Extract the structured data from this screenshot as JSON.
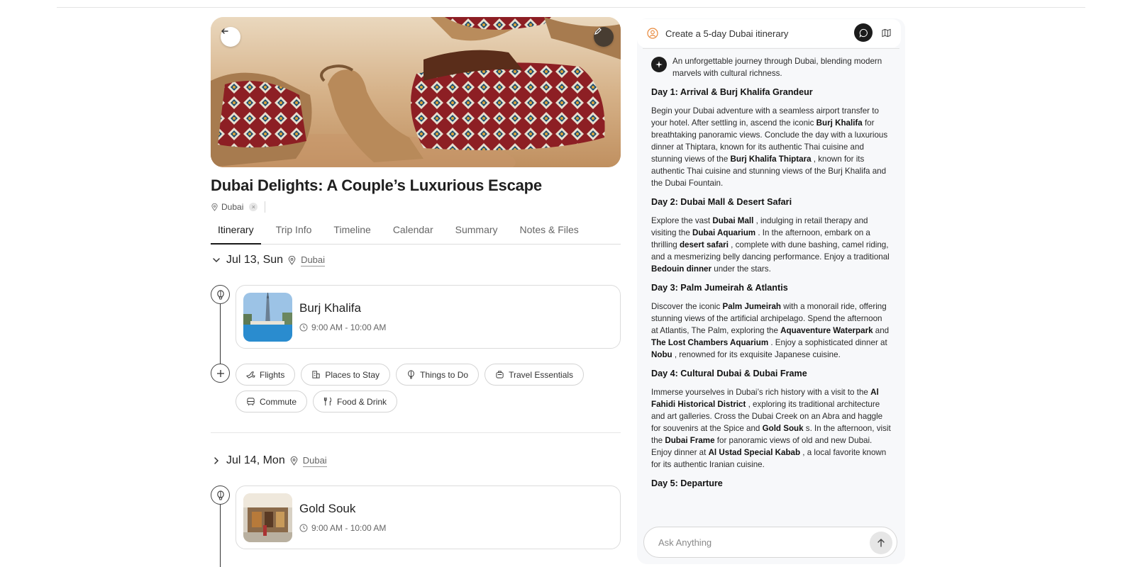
{
  "trip": {
    "title": "Dubai Delights: A Couple’s Luxurious Escape",
    "location": "Dubai",
    "remove_glyph": "×"
  },
  "tabs": [
    "Itinerary",
    "Trip Info",
    "Timeline",
    "Calendar",
    "Summary",
    "Notes & Files"
  ],
  "days": [
    {
      "date": "Jul 13, Sun",
      "place": "Dubai",
      "activity": {
        "name": "Burj Khalifa",
        "time": "9:00 AM - 10:00 AM"
      }
    },
    {
      "date": "Jul 14, Mon",
      "place": "Dubai",
      "activity": {
        "name": "Gold Souk",
        "time": "9:00 AM - 10:00 AM"
      }
    }
  ],
  "chips": {
    "flights": "Flights",
    "stay": "Places to Stay",
    "todo": "Things to Do",
    "essentials": "Travel Essentials",
    "commute": "Commute",
    "food": "Food & Drink"
  },
  "chat": {
    "prompt": "Create a 5-day Dubai itinerary",
    "intro": "An unforgettable journey through Dubai, blending modern marvels with cultural richness.",
    "d1_title": "Day 1: Arrival & Burj Khalifa Grandeur",
    "d1": [
      "Begin your Dubai adventure with a seamless airport transfer to your hotel. After settling in, ascend the iconic ",
      "Burj Khalifa",
      " for breathtaking panoramic views. Conclude the day with a luxurious dinner at Thiptara, known for its authentic Thai cuisine and stunning views of the ",
      "Burj Khalifa",
      " ",
      "Thiptara",
      " , known for its authentic Thai cuisine and stunning views of the Burj Khalifa and the Dubai Fountain."
    ],
    "d2_title": "Day 2: Dubai Mall & Desert Safari",
    "d2": [
      "Explore the vast ",
      "Dubai Mall",
      " , indulging in retail therapy and visiting the ",
      "Dubai Aquarium",
      " . In the afternoon, embark on a thrilling ",
      "desert safari",
      " , complete with dune bashing, camel riding, and a mesmerizing belly dancing performance. Enjoy a traditional ",
      "Bedouin dinner",
      " under the stars."
    ],
    "d3_title": "Day 3: Palm Jumeirah & Atlantis",
    "d3": [
      "Discover the iconic ",
      "Palm Jumeirah",
      " with a monorail ride, offering stunning views of the artificial archipelago. Spend the afternoon at Atlantis, The Palm, exploring the ",
      "Aquaventure Waterpark",
      " and ",
      "The Lost Chambers Aquarium",
      " . Enjoy a sophisticated dinner at ",
      "Nobu",
      " , renowned for its exquisite Japanese cuisine."
    ],
    "d4_title": "Day 4: Cultural Dubai & Dubai Frame",
    "d4": [
      "Immerse yourselves in Dubai’s rich history with a visit to the ",
      "Al Fahidi Historical District",
      " , exploring its traditional architecture and art galleries. Cross the Dubai Creek on an Abra and haggle for souvenirs at the Spice and ",
      "Gold Souk",
      " s. In the afternoon, visit the ",
      "Dubai Frame",
      " for panoramic views of old and new Dubai. Enjoy dinner at ",
      "Al Ustad Special Kabab",
      " , a local favorite known for its authentic Iranian cuisine."
    ],
    "d5_title": "Day 5: Departure",
    "ask_placeholder": "Ask Anything"
  },
  "icons": {
    "back": "arrow-left-icon",
    "edit": "pencil-icon",
    "pin": "map-pin-icon",
    "clock": "clock-icon",
    "balloon": "balloon-icon",
    "plus": "plus-icon",
    "send": "arrow-up-icon"
  },
  "colors": {
    "accent_orange": "#e8883a",
    "dark": "#1c1c1c"
  }
}
